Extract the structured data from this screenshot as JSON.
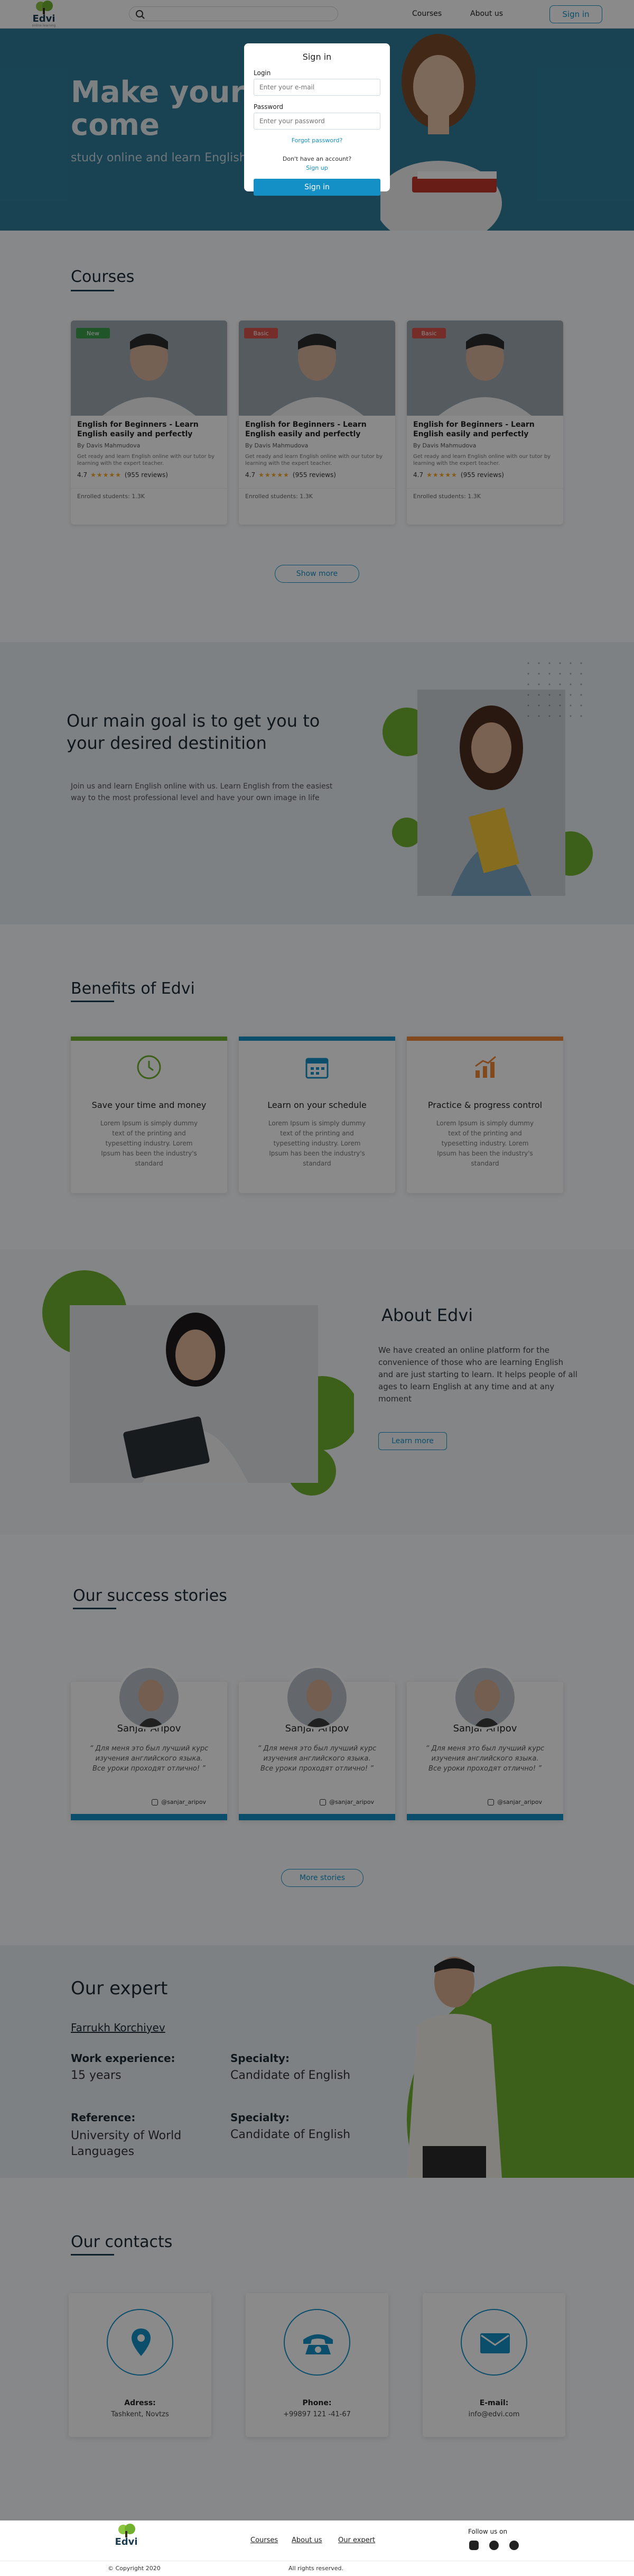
{
  "header": {
    "logo_text": "Edvi",
    "logo_sub": "online learning",
    "search_placeholder": "",
    "nav": [
      "Courses",
      "About us"
    ],
    "signin_label": "Sign in"
  },
  "hero": {
    "title": "Make your dream come",
    "subtitle": "study online and learn English"
  },
  "courses": {
    "title": "Courses",
    "cards": [
      {
        "badge": "New",
        "badge_color": "#3a9d4a",
        "title": "English for Beginners - Learn English easily and perfectly",
        "author": "By Davis Mahmudova",
        "desc": "Get ready and learn English online with our tutor by learning with the expert teacher.",
        "rating": "4.7",
        "reviews": "(955 reviews)",
        "foot": "Enrolled students: 1.3K"
      },
      {
        "badge": "Basic",
        "badge_color": "#d9534f",
        "title": "English for Beginners - Learn English easily and perfectly",
        "author": "By Davis Mahmudova",
        "desc": "Get ready and learn English online with our tutor by learning with the expert teacher.",
        "rating": "4.7",
        "reviews": "(955 reviews)",
        "foot": "Enrolled students: 1.3K"
      },
      {
        "badge": "Basic",
        "badge_color": "#d9534f",
        "title": "English for Beginners - Learn English easily and perfectly",
        "author": "By Davis Mahmudova",
        "desc": "Get ready and learn English online with our tutor by learning with the expert teacher.",
        "rating": "4.7",
        "reviews": "(955 reviews)",
        "foot": "Enrolled students: 1.3K"
      }
    ],
    "show_more": "Show more"
  },
  "goal": {
    "title": "Our main goal is to get you to your desired destinition",
    "text": "Join us and learn English online with us. Learn English from the easiest way to the most professional level and have your own image in life"
  },
  "benefits": {
    "title": "Benefits of Edvi",
    "cards": [
      {
        "title": "Save your time and money",
        "text": "Lorem Ipsum is simply dummy text of the printing and typesetting industry. Lorem Ipsum has been the industry's standard",
        "bar": "#6fb12f",
        "icon": "clock-icon"
      },
      {
        "title": "Learn on your schedule",
        "text": "Lorem Ipsum is simply dummy text of the printing and typesetting industry. Lorem Ipsum has been the industry's standard",
        "bar": "#1590c7",
        "icon": "calendar-icon"
      },
      {
        "title": "Practice & progress control",
        "text": "Lorem Ipsum is simply dummy text of the printing and typesetting industry. Lorem Ipsum has been the industry's standard",
        "bar": "#f0883a",
        "icon": "chart-icon"
      }
    ]
  },
  "about": {
    "title": "About Edvi",
    "text": "We have created an online platform for the convenience of those who are learning English and are just starting to learn. It helps people of all ages to learn English at any time and at any moment",
    "button": "Learn more"
  },
  "stories": {
    "title": "Our success stories",
    "cards": [
      {
        "name": "Sanjar Aripov",
        "text": "“ Для меня это был лучший курс изучения английского языка. Все уроки проходят отлично! ”",
        "link": "@sanjar_aripov"
      },
      {
        "name": "Sanjar Aripov",
        "text": "“ Для меня это был лучший курс изучения английского языка. Все уроки проходят отлично! ”",
        "link": "@sanjar_aripov"
      },
      {
        "name": "Sanjar Aripov",
        "text": "“ Для меня это был лучший курс изучения английского языка. Все уроки проходят отлично! ”",
        "link": "@sanjar_aripov"
      }
    ],
    "more": "More stories"
  },
  "expert": {
    "title": "Our expert",
    "name": "Farrukh Korchiyev",
    "work_label": "Work experience:",
    "work_value": "15 years",
    "specialty_label": "Specialty:",
    "specialty_value": "Candidate of English",
    "reference_label": "Reference:",
    "reference_value": "University of World Languages",
    "specialty2_label": "Specialty:",
    "specialty2_value": "Candidate of English"
  },
  "contacts": {
    "title": "Our contacts",
    "cards": [
      {
        "label": "Adress:",
        "value": "Tashkent, Novtzs",
        "icon": "location-icon"
      },
      {
        "label": "Phone:",
        "value": "+99897 121 -41-67",
        "icon": "phone-icon"
      },
      {
        "label": "E-mail:",
        "value": "info@edvi.com",
        "icon": "mail-icon"
      }
    ]
  },
  "footer": {
    "logo_text": "Edvi",
    "links": [
      "Courses",
      "About us",
      "Our expert"
    ],
    "follow": "Follow us on",
    "copyright": "© Copyright 2020",
    "rights": "All rights reserved."
  },
  "modal": {
    "title": "Sign in",
    "login_label": "Login",
    "login_placeholder": "Enter your e-mail",
    "password_label": "Password",
    "password_placeholder": "Enter your password",
    "forgot": "Forgot password?",
    "no_account": "Don't have an account?",
    "signup": "Sign up",
    "button": "Sign in"
  }
}
